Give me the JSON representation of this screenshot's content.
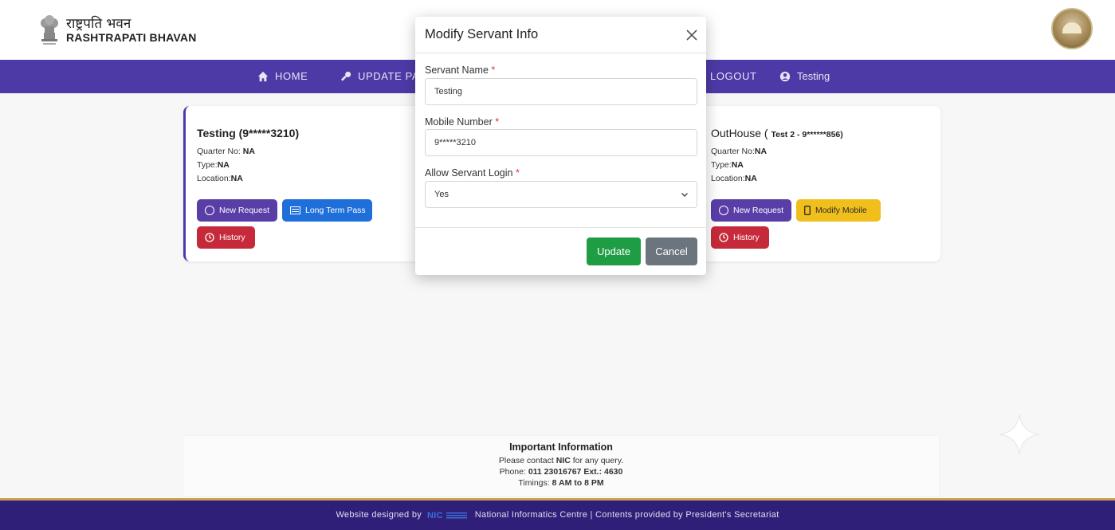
{
  "header": {
    "brand_hindi": "राष्ट्रपति भवन",
    "brand_english": "RASHTRAPATI BHAVAN"
  },
  "nav": {
    "home": "HOME",
    "update_pass": "UPDATE PASS",
    "logout": "LOGOUT",
    "user": "Testing"
  },
  "cards": {
    "left": {
      "name": "Testing (9*****3210)",
      "quarter_label": "Quarter No:",
      "quarter_value": "NA",
      "type_label": "Type:",
      "type_value": "NA",
      "location_label": "Location:",
      "location_value": "NA",
      "new_request": "New Request",
      "long_term_pass": "Long Term Pass",
      "history": "History"
    },
    "right": {
      "name": "OutHouse (",
      "name_sub": "Test 2 - 9******856)",
      "quarter_label": "Quarter No:",
      "quarter_value": "NA",
      "type_label": "Type:",
      "type_value": "NA",
      "location_label": "Location:",
      "location_value": "NA",
      "new_request": "New Request",
      "modify_mobile": "Modify Mobile",
      "history": "History"
    }
  },
  "modal": {
    "title": "Modify Servant Info",
    "servant_name_label": "Servant Name",
    "servant_name_value": "Testing",
    "mobile_label": "Mobile Number",
    "mobile_value": "9*****3210",
    "allow_login_label": "Allow Servant Login",
    "allow_login_value": "Yes",
    "required_mark": "*",
    "update": "Update",
    "cancel": "Cancel"
  },
  "info": {
    "title": "Important Information",
    "line1_pre": "Please contact",
    "line1_bold": "NIC",
    "line1_post": "for any query.",
    "line2_pre": "Phone:",
    "line2_bold": "011 23016767 Ext.: 4630",
    "line3_pre": "Timings:",
    "line3_bold": "8 AM to 8 PM"
  },
  "footer": {
    "designed_by": "Website designed by",
    "credit": "National Informatics Centre | Contents provided by President's Secretariat"
  },
  "colors": {
    "nav": "#4e3aa7",
    "footer": "#2f1f78",
    "update": "#1f9d44",
    "cancel": "#6c757d"
  }
}
